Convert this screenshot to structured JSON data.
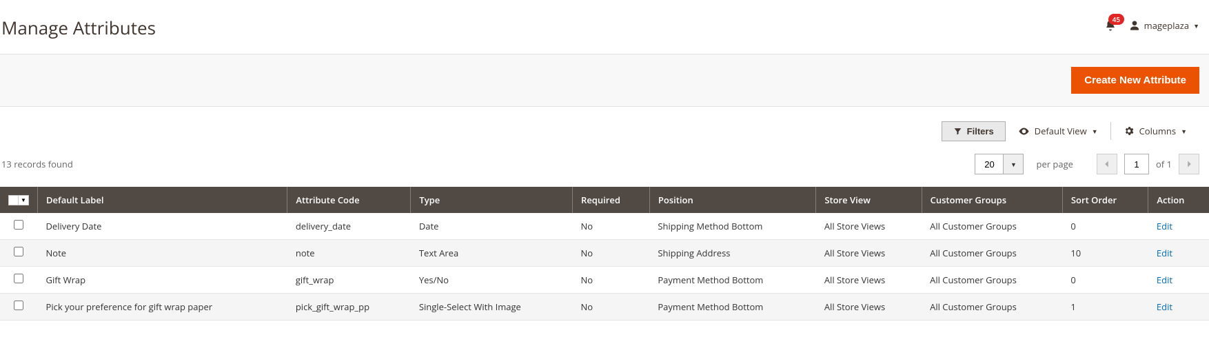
{
  "header": {
    "title": "Manage Attributes",
    "notification_count": "45",
    "username": "mageplaza"
  },
  "actions": {
    "create_button": "Create New Attribute"
  },
  "toolbar": {
    "filters": "Filters",
    "default_view": "Default View",
    "columns": "Columns"
  },
  "pager": {
    "records_found": "13 records found",
    "page_size": "20",
    "per_page_label": "per page",
    "current_page": "1",
    "of_label": "of",
    "total_pages": "1"
  },
  "grid": {
    "headers": {
      "default_label": "Default Label",
      "attribute_code": "Attribute Code",
      "type": "Type",
      "required": "Required",
      "position": "Position",
      "store_view": "Store View",
      "customer_groups": "Customer Groups",
      "sort_order": "Sort Order",
      "action": "Action"
    },
    "rows": [
      {
        "default_label": "Delivery Date",
        "attribute_code": "delivery_date",
        "type": "Date",
        "required": "No",
        "position": "Shipping Method Bottom",
        "store_view": "All Store Views",
        "customer_groups": "All Customer Groups",
        "sort_order": "0",
        "action": "Edit"
      },
      {
        "default_label": "Note",
        "attribute_code": "note",
        "type": "Text Area",
        "required": "No",
        "position": "Shipping Address",
        "store_view": "All Store Views",
        "customer_groups": "All Customer Groups",
        "sort_order": "10",
        "action": "Edit"
      },
      {
        "default_label": "Gift Wrap",
        "attribute_code": "gift_wrap",
        "type": "Yes/No",
        "required": "No",
        "position": "Payment Method Bottom",
        "store_view": "All Store Views",
        "customer_groups": "All Customer Groups",
        "sort_order": "0",
        "action": "Edit"
      },
      {
        "default_label": "Pick your preference for gift wrap paper",
        "attribute_code": "pick_gift_wrap_pp",
        "type": "Single-Select With Image",
        "required": "No",
        "position": "Payment Method Bottom",
        "store_view": "All Store Views",
        "customer_groups": "All Customer Groups",
        "sort_order": "1",
        "action": "Edit"
      }
    ]
  }
}
